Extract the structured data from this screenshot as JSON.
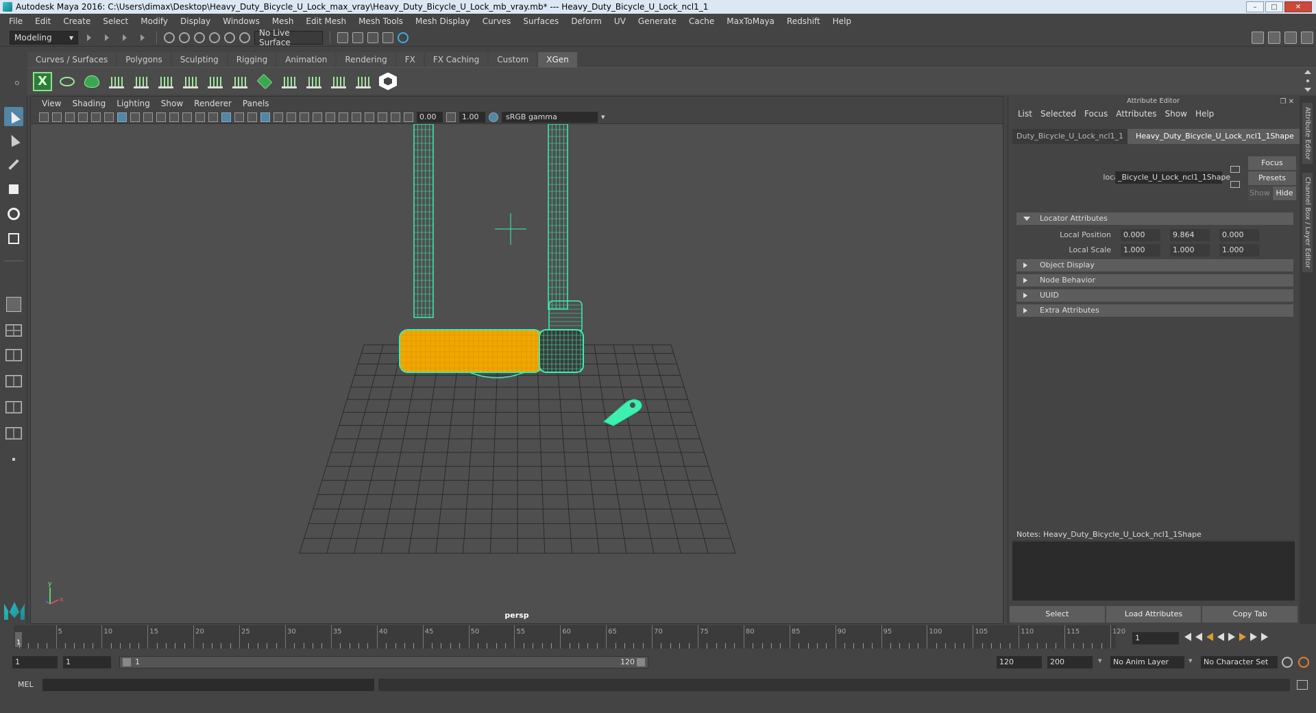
{
  "window": {
    "title": "Autodesk Maya 2016: C:\\Users\\dimax\\Desktop\\Heavy_Duty_Bicycle_U_Lock_max_vray\\Heavy_Duty_Bicycle_U_Lock_mb_vray.mb*   ---   Heavy_Duty_Bicycle_U_Lock_ncl1_1",
    "minimize": "–",
    "maximize": "□",
    "close": "✕"
  },
  "menubar": [
    "File",
    "Edit",
    "Create",
    "Select",
    "Modify",
    "Display",
    "Windows",
    "Mesh",
    "Edit Mesh",
    "Mesh Tools",
    "Mesh Display",
    "Curves",
    "Surfaces",
    "Deform",
    "UV",
    "Generate",
    "Cache",
    "MaxToMaya",
    "Redshift",
    "Help"
  ],
  "statusline": {
    "mode": "Modeling",
    "live_surface": "No Live Surface"
  },
  "shelf_tabs": [
    "Curves / Surfaces",
    "Polygons",
    "Sculpting",
    "Rigging",
    "Animation",
    "Rendering",
    "FX",
    "FX Caching",
    "Custom",
    "XGen"
  ],
  "shelf_active": "XGen",
  "shelf_xgen_label": "X",
  "viewport": {
    "menu": [
      "View",
      "Shading",
      "Lighting",
      "Show",
      "Renderer",
      "Panels"
    ],
    "exposure": "0.00",
    "gamma_value": "1.00",
    "color_space": "sRGB gamma",
    "camera_label": "persp",
    "axis_y": "y",
    "axis_x": "x",
    "colors": {
      "wire": "#3cf0b0",
      "selected_fill": "#f0a800",
      "grid": "#2a2a2a"
    }
  },
  "attr_editor": {
    "title": "Attribute Editor",
    "menu": [
      "List",
      "Selected",
      "Focus",
      "Attributes",
      "Show",
      "Help"
    ],
    "tab_left": "Duty_Bicycle_U_Lock_ncl1_1",
    "tab_active": "Heavy_Duty_Bicycle_U_Lock_ncl1_1Shape",
    "node_label": "locator:",
    "node_value": "_Bicycle_U_Lock_ncl1_1Shape",
    "focus_btn": "Focus",
    "presets_btn": "Presets",
    "show_btn": "Show",
    "hide_btn": "Hide",
    "sections": {
      "locator_attributes": "Locator Attributes",
      "object_display": "Object Display",
      "node_behavior": "Node Behavior",
      "uuid": "UUID",
      "extra_attributes": "Extra Attributes"
    },
    "local_position": {
      "label": "Local Position",
      "x": "0.000",
      "y": "9.864",
      "z": "0.000"
    },
    "local_scale": {
      "label": "Local Scale",
      "x": "1.000",
      "y": "1.000",
      "z": "1.000"
    },
    "notes_label": "Notes:  Heavy_Duty_Bicycle_U_Lock_ncl1_1Shape",
    "bottom": {
      "select": "Select",
      "load": "Load Attributes",
      "copy": "Copy Tab"
    }
  },
  "side_tabs": {
    "attribute_editor": "Attribute Editor",
    "channel_box": "Channel Box / Layer Editor"
  },
  "timeline": {
    "labels": [
      "5",
      "10",
      "15",
      "20",
      "25",
      "30",
      "35",
      "40",
      "45",
      "50",
      "55",
      "60",
      "65",
      "70",
      "75",
      "80",
      "85",
      "90",
      "95",
      "100",
      "105",
      "110",
      "115",
      "120"
    ],
    "current_frame": "1",
    "current_frame_field": "1"
  },
  "range": {
    "start": "1",
    "playback_start": "1",
    "slider_start": "1",
    "slider_end": "120",
    "playback_end": "120",
    "end": "200",
    "anim_layer": "No Anim Layer",
    "char_set": "No Character Set"
  },
  "cmdline": {
    "mode": "MEL"
  }
}
